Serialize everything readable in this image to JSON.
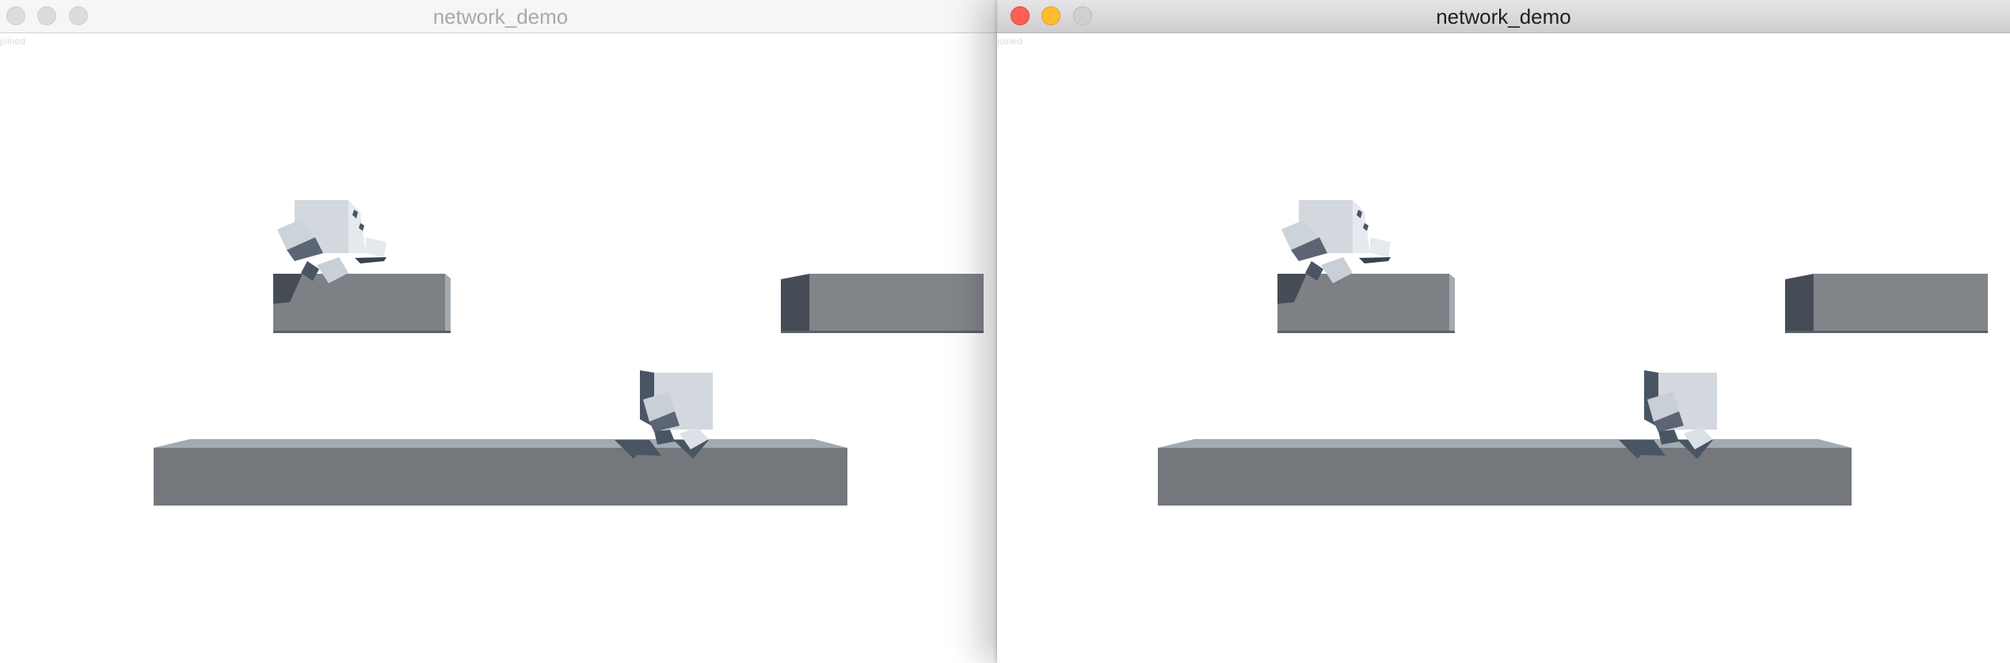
{
  "left_window": {
    "title": "network_demo",
    "status": "joined",
    "active": false
  },
  "right_window": {
    "title": "network_demo",
    "status": "joined",
    "active": true
  },
  "colors": {
    "platform_front": "#7b7f83",
    "platform_top": "#a2aab2",
    "platform_side_dark": "#454c55",
    "character_light": "#d3d8de",
    "character_shadow": "#4a5563",
    "window_background": "#ffffff"
  },
  "icons": [
    "close-icon",
    "minimize-icon",
    "zoom-icon"
  ]
}
